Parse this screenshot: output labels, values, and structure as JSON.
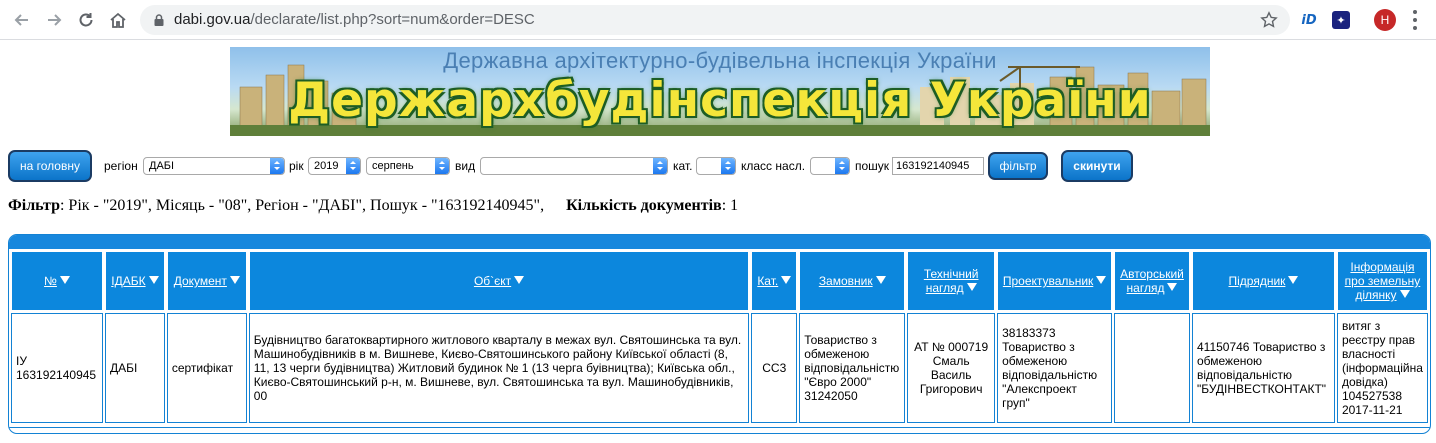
{
  "browser": {
    "url_host": "dabi.gov.ua",
    "url_path": "/declarate/list.php?sort=num&order=DESC",
    "profile_initial": "H"
  },
  "banner": {
    "subtitle": "Державна архітектурно-будівельна інспекція України",
    "title": "Держархбудінспекція України"
  },
  "filters": {
    "home_label": "на головну",
    "region_label": "регіон",
    "region_value": "ДАБІ",
    "year_label": "рік",
    "year_value": "2019",
    "month_value": "серпень",
    "type_label": "вид",
    "type_value": "",
    "cat_label": "кат.",
    "cat_value": "",
    "class_label": "класс насл.",
    "class_value": "",
    "search_label": "пошук",
    "search_value": "163192140945",
    "filter_label": "фільтр",
    "reset_label": "скинути"
  },
  "summary": {
    "filter_label": "Фільтр",
    "filter_text": ": Рік - \"2019\", Місяць - \"08\", Регіон - \"ДАБІ\", Пошук - \"163192140945\",",
    "count_label": "Кількість документів",
    "count_value": ": 1"
  },
  "table": {
    "headers": {
      "num": "№",
      "idabk": "IДАБК",
      "doc": "Документ",
      "object": "Об`єкт",
      "cat": "Кат.",
      "customer_l1": "Замовник",
      "tech_l1": "Технічний",
      "tech_l2": "нагляд",
      "designer": "Проектувальник",
      "author_l1": "Авторський",
      "author_l2": "нагляд",
      "contractor": "Підрядник",
      "land_l1": "Інформація",
      "land_l2": "про земельну",
      "land_l3": "ділянку"
    },
    "rows": [
      {
        "num_l1": "ІУ",
        "num_l2": "163192140945",
        "idabk": "ДАБІ",
        "doc": "сертифікат",
        "object": "Будівництво багатоквартирного житлового кварталу в межах вул. Святошинська та вул. Машинобудівників в м. Вишневе, Києво-Святошинського району Київської області (8, 11, 13 черги будівництва) Житловий будинок № 1 (13 черга буівництва); Київська обл., Києво-Святошинський р-н, м. Вишневе, вул. Святошинська та вул. Машинобудівників, 00",
        "cat": "СС3",
        "customer": "Товариство з обмеженою відповідальністю \"Євро 2000\" 31242050",
        "tech": "АТ № 000719 Смаль Василь Григорович",
        "designer": "38183373 Товариство з обмеженою відповідальністю \"Алекспроект груп\"",
        "author": "",
        "contractor": "41150746 Товариство з обмеженою відповідальністю \"БУДІНВЕСТКОНТАКТ\"",
        "land": "витяг з реєстру прав власності (інформаційна довідка) 104527538 2017-11-21"
      }
    ]
  }
}
